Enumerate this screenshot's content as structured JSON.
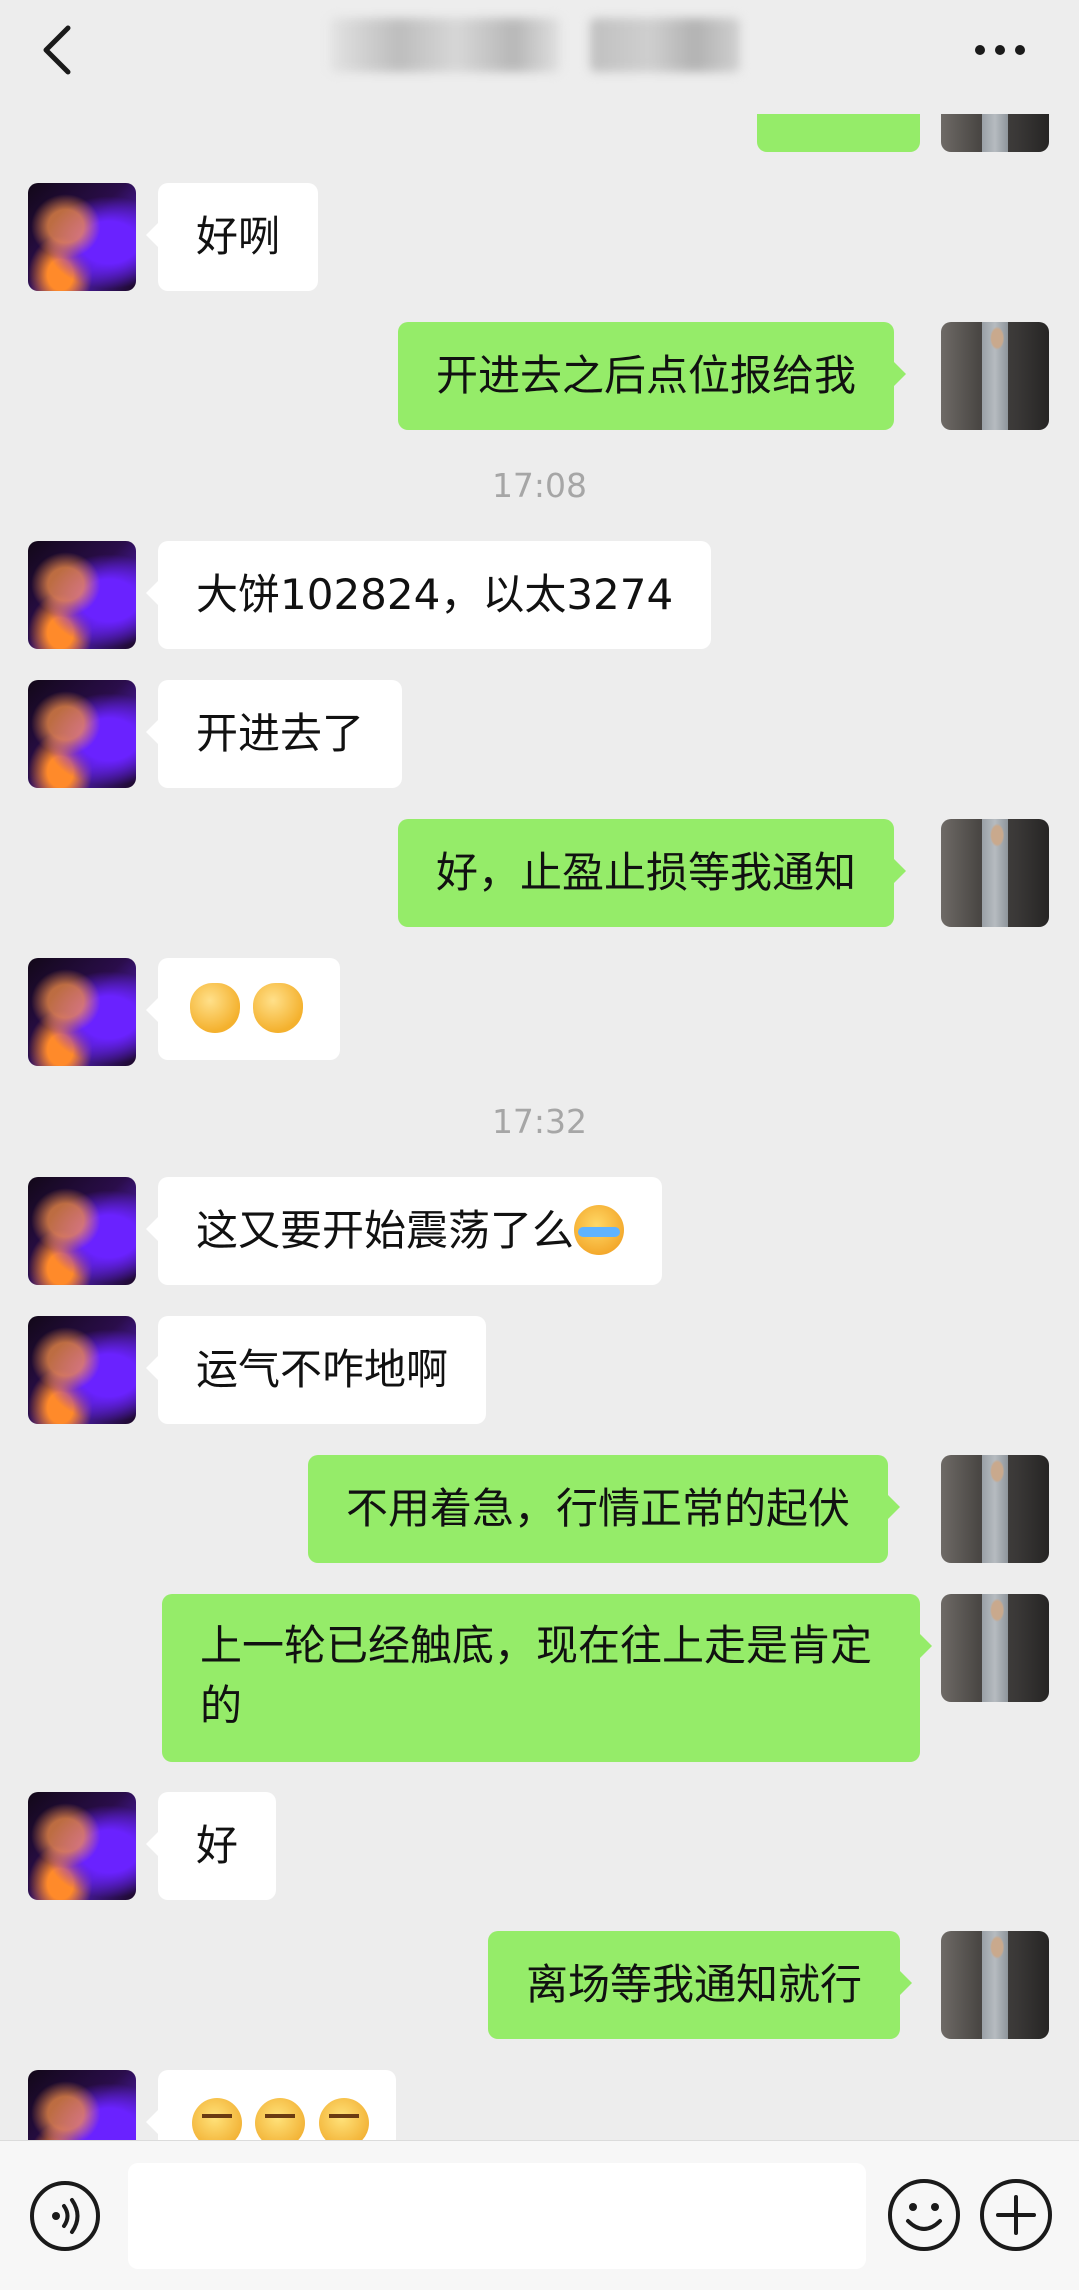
{
  "header": {
    "back_icon": "chevron-left-icon",
    "more_icon": "more-dots-icon"
  },
  "timestamps": [
    "17:08",
    "17:32"
  ],
  "messages": [
    {
      "side": "right",
      "text": ""
    },
    {
      "side": "left",
      "text": "好咧"
    },
    {
      "side": "right",
      "text": "开进去之后点位报给我"
    },
    {
      "side": "left",
      "text": "大饼102824，以太3274"
    },
    {
      "side": "left",
      "text": "开进去了"
    },
    {
      "side": "right",
      "text": "好，止盈止损等我通知"
    },
    {
      "side": "left",
      "emojis": [
        "ok-hand",
        "ok-hand"
      ]
    },
    {
      "side": "left",
      "text": "这又要开始震荡了么",
      "emojis": [
        "crying-laughing"
      ]
    },
    {
      "side": "left",
      "text": "运气不咋地啊"
    },
    {
      "side": "right",
      "text": "不用着急，行情正常的起伏"
    },
    {
      "side": "right",
      "text": "上一轮已经触底，现在往上走是肯定的"
    },
    {
      "side": "left",
      "text": "好"
    },
    {
      "side": "right",
      "text": "离场等我通知就行"
    },
    {
      "side": "left",
      "emojis": [
        "smirk",
        "smirk",
        "smirk"
      ]
    }
  ],
  "input_bar": {
    "voice_icon": "voice-icon",
    "emoji_icon": "emoji-icon",
    "plus_icon": "plus-icon",
    "input_value": ""
  }
}
